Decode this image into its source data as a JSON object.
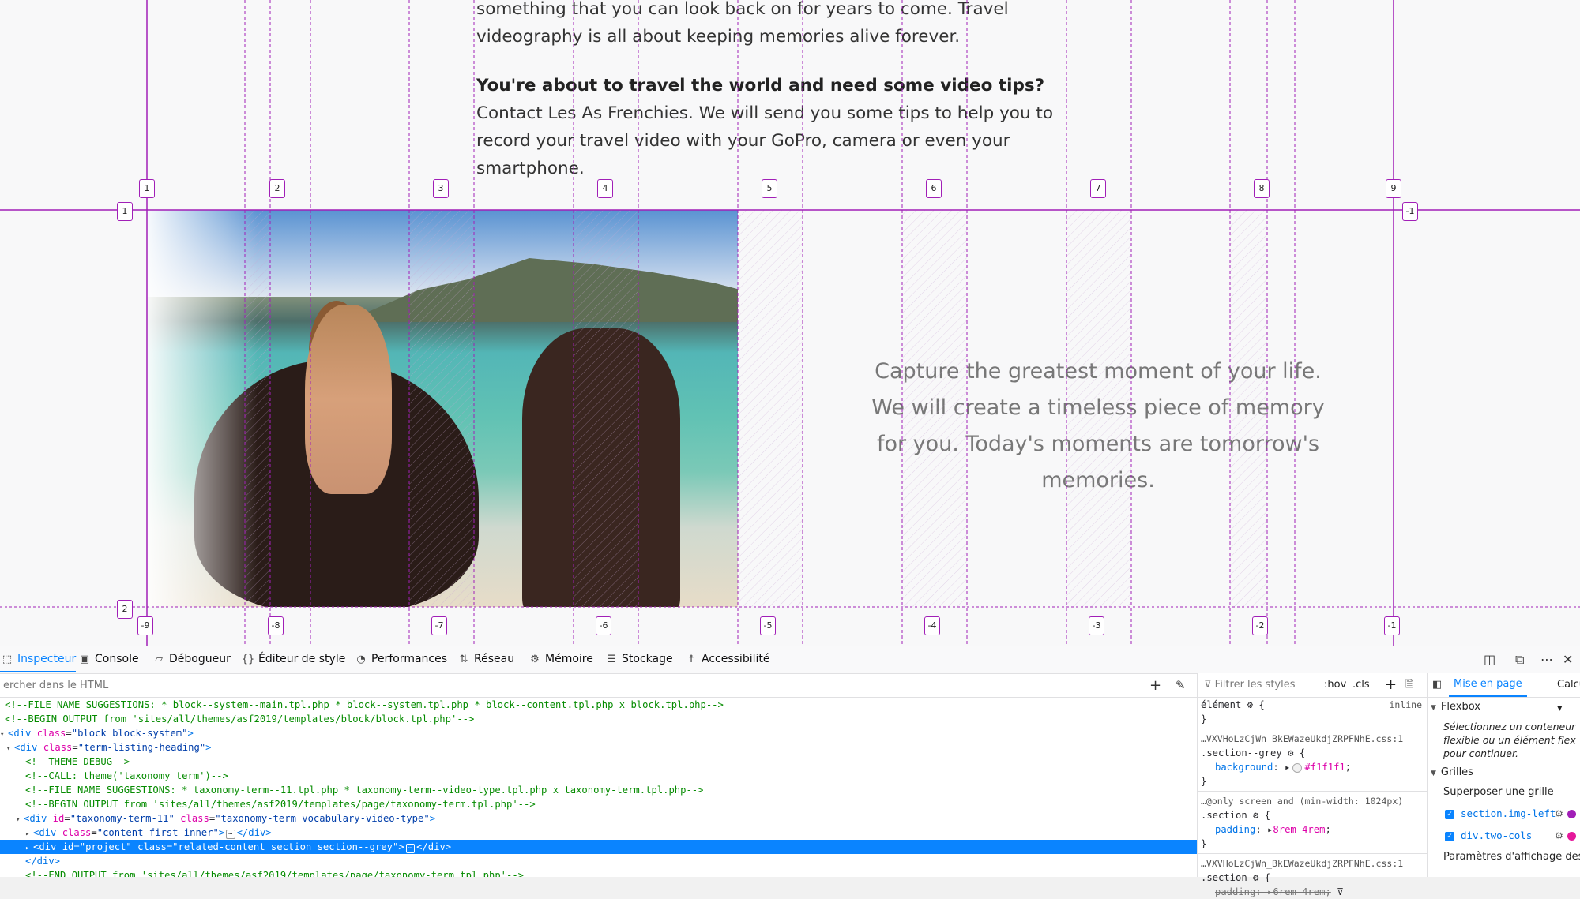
{
  "article": {
    "para1": "something that you can look back on for years to come. Travel videography is all about keeping memories alive forever.",
    "para2_bold": "You're about to travel the world and need some video tips?",
    "para2_rest": " Contact Les As Frenchies. We will send you some tips to help you to record your travel video with your GoPro, camera or even your smartphone.",
    "quote": "Capture the greatest moment of your life. We will create a timeless piece of memory for you. Today's moments are tomorrow's memories."
  },
  "grid_overlay": {
    "accent_color": "#a11fb7",
    "top_column_numbers": [
      "1",
      "2",
      "3",
      "4",
      "5",
      "6",
      "7",
      "8",
      "9"
    ],
    "bottom_column_numbers": [
      "-9",
      "-8",
      "-7",
      "-6",
      "-5",
      "-4",
      "-3",
      "-2",
      "-1"
    ],
    "left_row_numbers": [
      "1",
      "2"
    ],
    "right_row_number": "-1"
  },
  "devtools": {
    "tabs": [
      {
        "label": "Inspecteur",
        "icon": "inspector-icon",
        "active": true
      },
      {
        "label": "Console",
        "icon": "console-icon"
      },
      {
        "label": "Débogueur",
        "icon": "debugger-icon"
      },
      {
        "label": "Éditeur de style",
        "icon": "style-editor-icon"
      },
      {
        "label": "Performances",
        "icon": "performance-icon"
      },
      {
        "label": "Réseau",
        "icon": "network-icon"
      },
      {
        "label": "Mémoire",
        "icon": "memory-icon"
      },
      {
        "label": "Stockage",
        "icon": "storage-icon"
      },
      {
        "label": "Accessibilité",
        "icon": "accessibility-icon"
      }
    ],
    "search_placeholder": "ercher dans le HTML",
    "html_lines": {
      "l1": "<!--FILE NAME SUGGESTIONS: * block--system--main.tpl.php * block--system.tpl.php * block--content.tpl.php x block.tpl.php-->",
      "l2": "<!--BEGIN OUTPUT from 'sites/all/themes/asf2019/templates/block/block.tpl.php'-->",
      "l3_tag": "div",
      "l3_attr": "class",
      "l3_val": "\"block block-system\"",
      "l4_tag": "div",
      "l4_attr": "class",
      "l4_val": "\"term-listing-heading\"",
      "l5": "<!--THEME DEBUG-->",
      "l6": "<!--CALL: theme('taxonomy_term')-->",
      "l7": "<!--FILE NAME SUGGESTIONS: * taxonomy-term--11.tpl.php * taxonomy-term--video-type.tpl.php x taxonomy-term.tpl.php-->",
      "l8": "<!--BEGIN OUTPUT from 'sites/all/themes/asf2019/templates/page/taxonomy-term.tpl.php'-->",
      "l9_tag": "div",
      "l9_attr1": "id",
      "l9_val1": "\"taxonomy-term-11\"",
      "l9_attr2": "class",
      "l9_val2": "\"taxonomy-term vocabulary-video-type\"",
      "l10_tag": "div",
      "l10_attr": "class",
      "l10_val": "\"content-first-inner\"",
      "l10_close": "</div>",
      "l11_tag": "div",
      "l11_attr1": "id",
      "l11_val1": "\"project\"",
      "l11_attr2": "class",
      "l11_val2": "\"related-content section section--grey\"",
      "l11_close": "</div>",
      "l12": "</div>",
      "l13": "<!--END OUTPUT from 'sites/all/themes/asf2019/templates/page/taxonomy-term.tpl.php'-->"
    },
    "rules": {
      "filter_placeholder": "Filtrer les styles",
      "hov": ":hov",
      "cls": ".cls",
      "element_selector": "élément",
      "element_origin": "inline",
      "src1": "…VXVHoLzCjWn_BkEWazeUkdjZRPFNhE.css:1",
      "sel1": ".section--grey",
      "prop1": "background",
      "val1": "#f1f1f1",
      "media": "…@only screen and (min-width: 1024px)",
      "sel2": ".section",
      "prop2": "padding",
      "val2": "8rem 4rem",
      "src3": "…VXVHoLzCjWn_BkEWazeUkdjZRPFNhE.css:1",
      "sel3": ".section",
      "prop3": "padding",
      "val3": "6rem 4rem",
      "brace_open": "{",
      "brace_close": "}"
    },
    "layout_panel": {
      "tab_active": "Mise en page",
      "tab_other": "Calcu",
      "flexbox_title": "Flexbox",
      "flexbox_hint": "Sélectionnez un conteneur flexible ou un élément flex pour continuer.",
      "grids_title": "Grilles",
      "overlay_title": "Superposer une grille",
      "grid1": "section.img-left",
      "grid2": "div.two-cols",
      "grid2_color": "#e5189b",
      "display_settings": "Paramètres d'affichage des"
    }
  }
}
